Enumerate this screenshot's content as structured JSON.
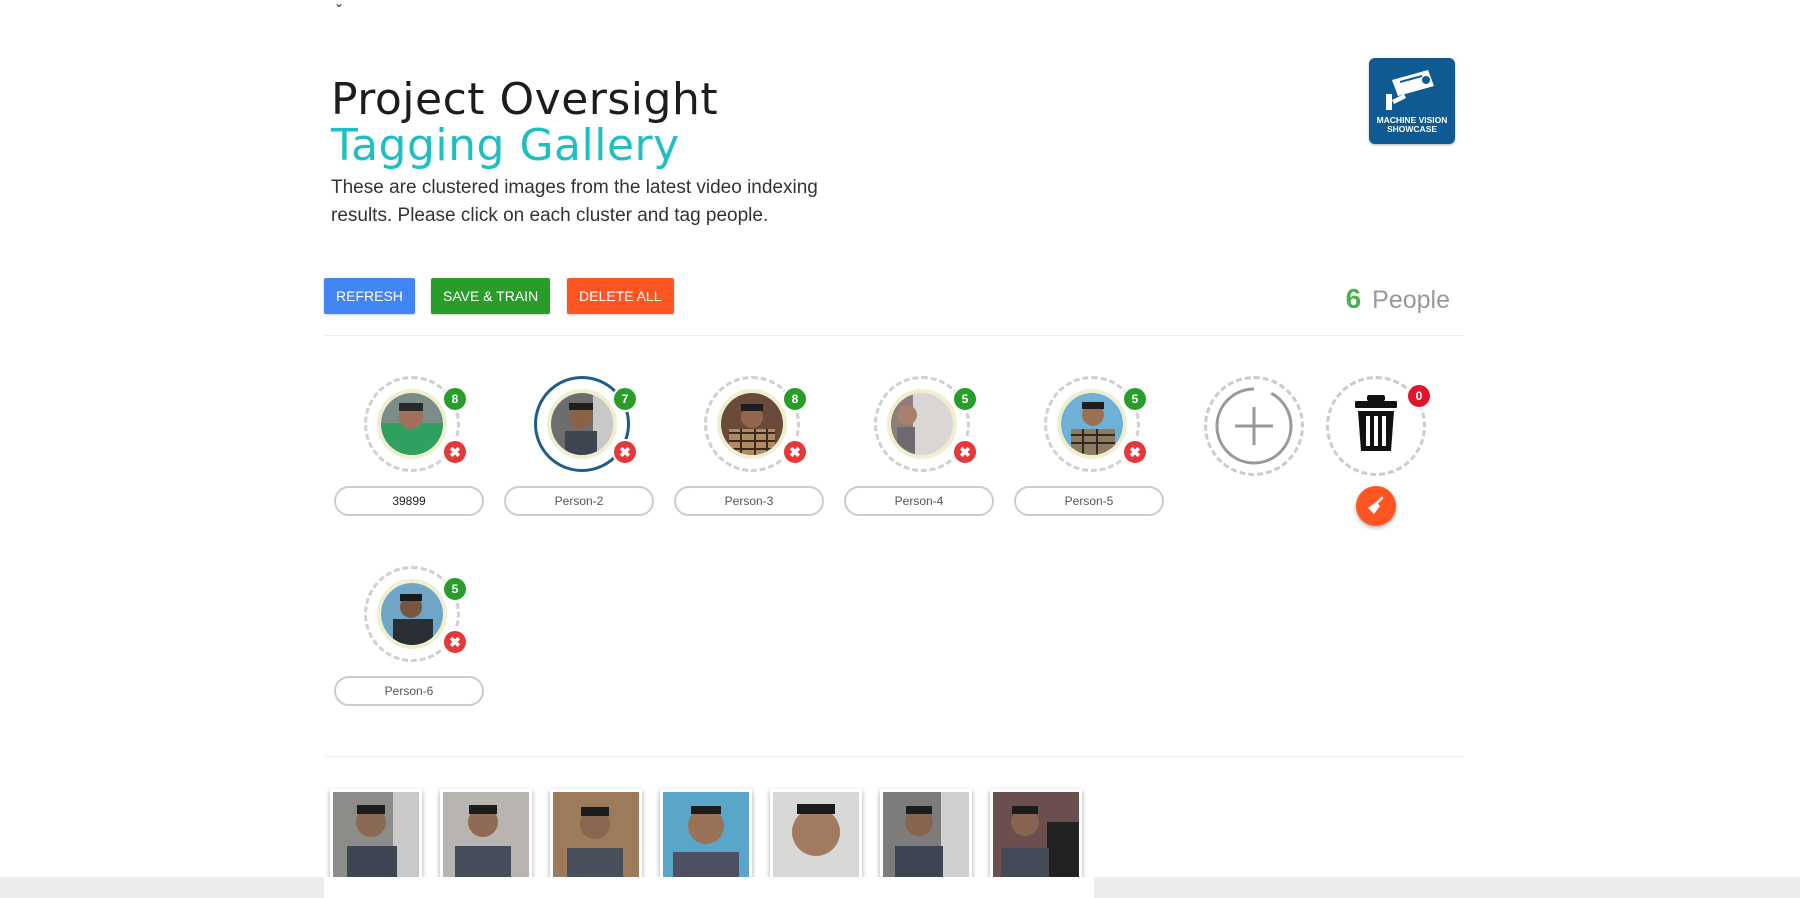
{
  "header": {
    "title": "Project Oversight",
    "subtitle": "Tagging Gallery",
    "description": "These are clustered images from the latest video indexing results. Please click on each cluster and tag people.",
    "logo_line1": "MACHINE VISION",
    "logo_line2": "SHOWCASE"
  },
  "toolbar": {
    "refresh_label": "REFRESH",
    "save_label": "SAVE & TRAIN",
    "delete_label": "DELETE ALL"
  },
  "people": {
    "count": "6",
    "label": "People"
  },
  "clusters": [
    {
      "name": "39899",
      "count": "8"
    },
    {
      "name": "Person-2",
      "count": "7"
    },
    {
      "name": "Person-3",
      "count": "8"
    },
    {
      "name": "Person-4",
      "count": "5"
    },
    {
      "name": "Person-5",
      "count": "5"
    },
    {
      "name": "Person-6",
      "count": "5"
    }
  ],
  "trash": {
    "count": "0"
  },
  "icons": {
    "remove": "close-icon",
    "add": "add-cluster-icon",
    "trash": "trash-icon",
    "sweep": "broom-icon",
    "logo": "security-camera-icon"
  },
  "colors": {
    "accent": "#1ebfc3",
    "refresh": "#4285f4",
    "save": "#299d2a",
    "delete": "#fe5522",
    "selected_ring": "#1f5c8b"
  }
}
